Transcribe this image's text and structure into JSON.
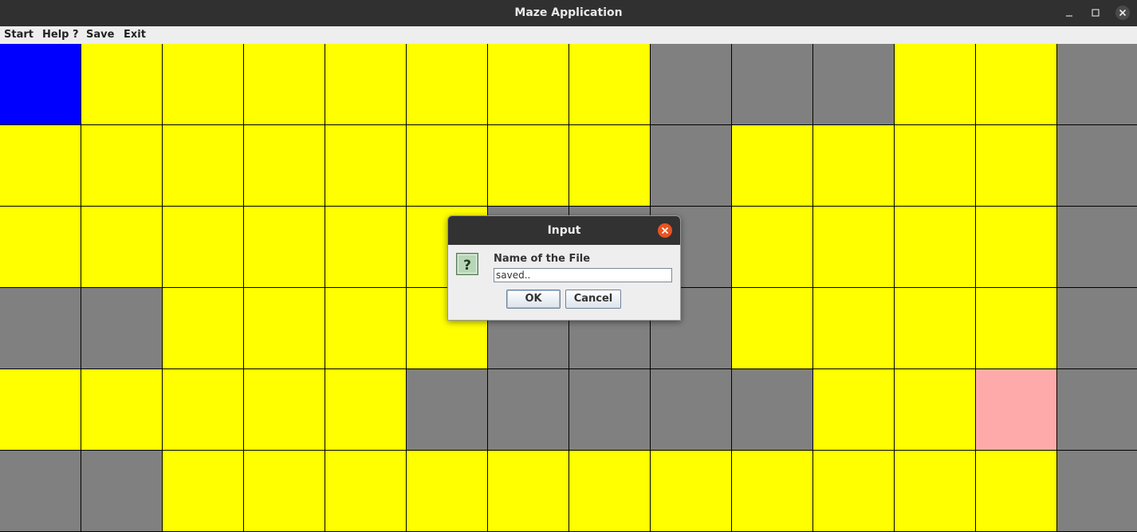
{
  "window": {
    "title": "Maze Application",
    "controls": [
      "minimize-icon",
      "maximize-icon",
      "close-icon"
    ]
  },
  "menu": {
    "items": [
      "Start",
      "Help ?",
      "Save",
      "Exit"
    ]
  },
  "maze": {
    "rows": 6,
    "cols": 14,
    "colors": {
      "Y": "#ffff00",
      "G": "#808080",
      "B": "#0000ff",
      "P": "#ffaaaa"
    },
    "cells": [
      "BYYYYYYYGGGYYG",
      "YYYYYYYYGYYYYG",
      "YYYYYYGGGYYYYG",
      "GGYYYYGGGYYYYG",
      "YYYYYGGGGGYYPG",
      "GGYYYYYYYYYYYG"
    ]
  },
  "dialog": {
    "title": "Input",
    "icon": "question-icon",
    "prompt": "Name of the File",
    "input_value": "saved..",
    "ok_label": "OK",
    "cancel_label": "Cancel"
  }
}
